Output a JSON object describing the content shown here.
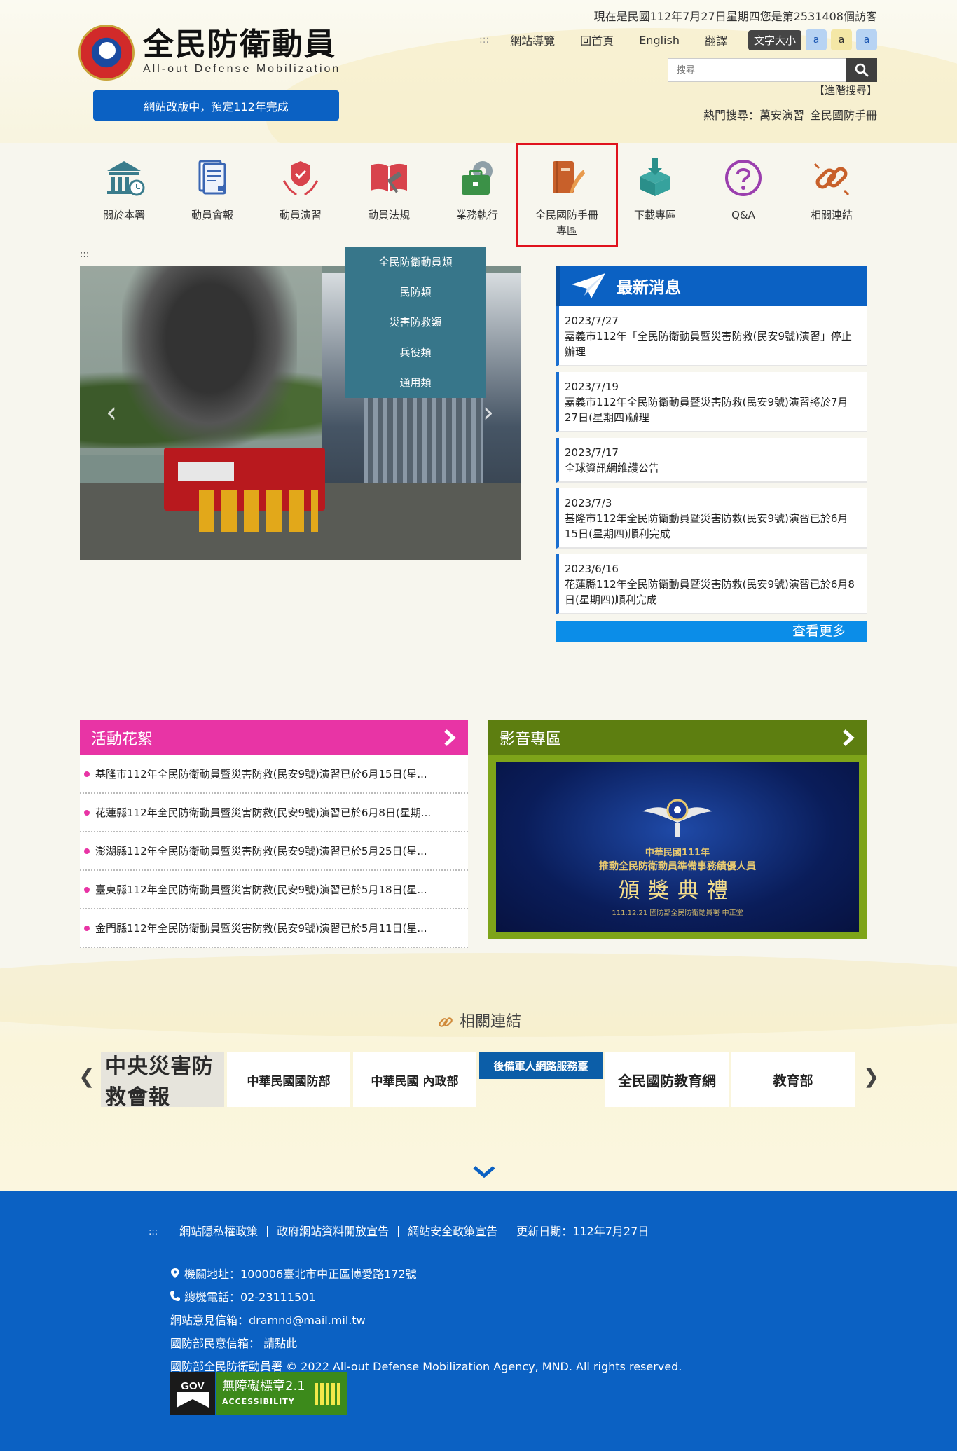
{
  "header": {
    "logo_zh": "全民防衛動員",
    "logo_en": "All-out Defense Mobilization",
    "revamp_notice": "網站改版中，預定112年完成",
    "visitor_prefix": "現在是民國112年7月27日星期四您是第",
    "visitor_count": "2531408",
    "visitor_suffix": "個訪客",
    "top_nav_sep": ":::",
    "top_nav": [
      "網站導覽",
      "回首頁",
      "English",
      "翻譯"
    ],
    "font_size_label": "文字大小",
    "font_buttons": [
      "a",
      "a",
      "a"
    ],
    "search_placeholder": "搜尋",
    "advanced_search": "【進階搜尋】",
    "hot_search_label": "熱門搜尋：",
    "hot_search_items": [
      "萬安演習",
      "全民國防手冊"
    ]
  },
  "main_nav": [
    {
      "label": "關於本署",
      "icon": "bank-icon"
    },
    {
      "label": "動員會報",
      "icon": "document-speaker-icon"
    },
    {
      "label": "動員演習",
      "icon": "shield-hands-icon"
    },
    {
      "label": "動員法規",
      "icon": "law-book-icon"
    },
    {
      "label": "業務執行",
      "icon": "briefcase-gear-icon"
    },
    {
      "label": "全民國防手冊專區",
      "icon": "handbook-feather-icon"
    },
    {
      "label": "下載專區",
      "icon": "download-box-icon"
    },
    {
      "label": "Q&A",
      "icon": "question-icon"
    },
    {
      "label": "相關連結",
      "icon": "chain-link-icon"
    }
  ],
  "dropdown": [
    "全民防衛動員類",
    "民防類",
    "災害防救類",
    "兵役類",
    "通用類"
  ],
  "anchor_mark": ":::",
  "carousel": {
    "prev": "‹",
    "next": "›"
  },
  "news": {
    "title": "最新消息",
    "items": [
      {
        "date": "2023/7/27",
        "text": "嘉義市112年「全民防衛動員暨災害防救(民安9號)演習」停止辦理"
      },
      {
        "date": "2023/7/19",
        "text": "嘉義市112年全民防衛動員暨災害防救(民安9號)演習將於7月27日(星期四)辦理"
      },
      {
        "date": "2023/7/17",
        "text": "全球資訊網維護公告"
      },
      {
        "date": "2023/7/3",
        "text": "基隆市112年全民防衛動員暨災害防救(民安9號)演習已於6月15日(星期四)順利完成"
      },
      {
        "date": "2023/6/16",
        "text": "花蓮縣112年全民防衛動員暨災害防救(民安9號)演習已於6月8日(星期四)順利完成"
      }
    ],
    "more": "查看更多"
  },
  "activities": {
    "title": "活動花絮",
    "items": [
      "基隆市112年全民防衛動員暨災害防救(民安9號)演習已於6月15日(星...",
      "花蓮縣112年全民防衛動員暨災害防救(民安9號)演習已於6月8日(星期...",
      "澎湖縣112年全民防衛動員暨災害防救(民安9號)演習已於5月25日(星...",
      "臺東縣112年全民防衛動員暨災害防救(民安9號)演習已於5月18日(星...",
      "金門縣112年全民防衛動員暨災害防救(民安9號)演習已於5月11日(星..."
    ]
  },
  "media": {
    "title": "影音專區",
    "video_line1": "中華民國111年",
    "video_line2": "推動全民防衛動員準備事務績優人員",
    "video_line3": "頒獎典禮",
    "video_line4": "111.12.21 國防部全民防衛動員署 中正堂"
  },
  "related": {
    "title": "相關連結",
    "prev": "❮",
    "next": "❯",
    "logos": [
      "中央災害防救會報",
      "中華民國國防部",
      "中華民國 內政部",
      "後備軍人網路服務臺",
      "全民國防教育網",
      "教育部"
    ]
  },
  "footer": {
    "lead": ":::",
    "links": [
      "網站隱私權政策",
      "政府網站資料開放宣告",
      "網站安全政策宣告",
      "更新日期：112年7月27日"
    ],
    "address": "機關地址：100006臺北市中正區博愛路172號",
    "phone": "總機電話：02-23111501",
    "email": "網站意見信箱：dramnd@mail.mil.tw",
    "mnd_mail_label": "國防部民意信箱：",
    "mnd_mail_link": "請點此",
    "copyright": "國防部全民防衛動員署 © 2022 All-out Defense Mobilization Agency, MND. All rights reserved.",
    "gov_badge": "GOV",
    "acc_badge_line1": "無障礙標章2.1",
    "acc_badge_line2": "ACCESSIBILITY"
  },
  "colors": {
    "primary_blue": "#0b61c3",
    "activities_pink": "#e834a5",
    "media_green": "#7ea419",
    "highlight_red": "#e0121d",
    "dropdown_teal": "#37768a"
  }
}
